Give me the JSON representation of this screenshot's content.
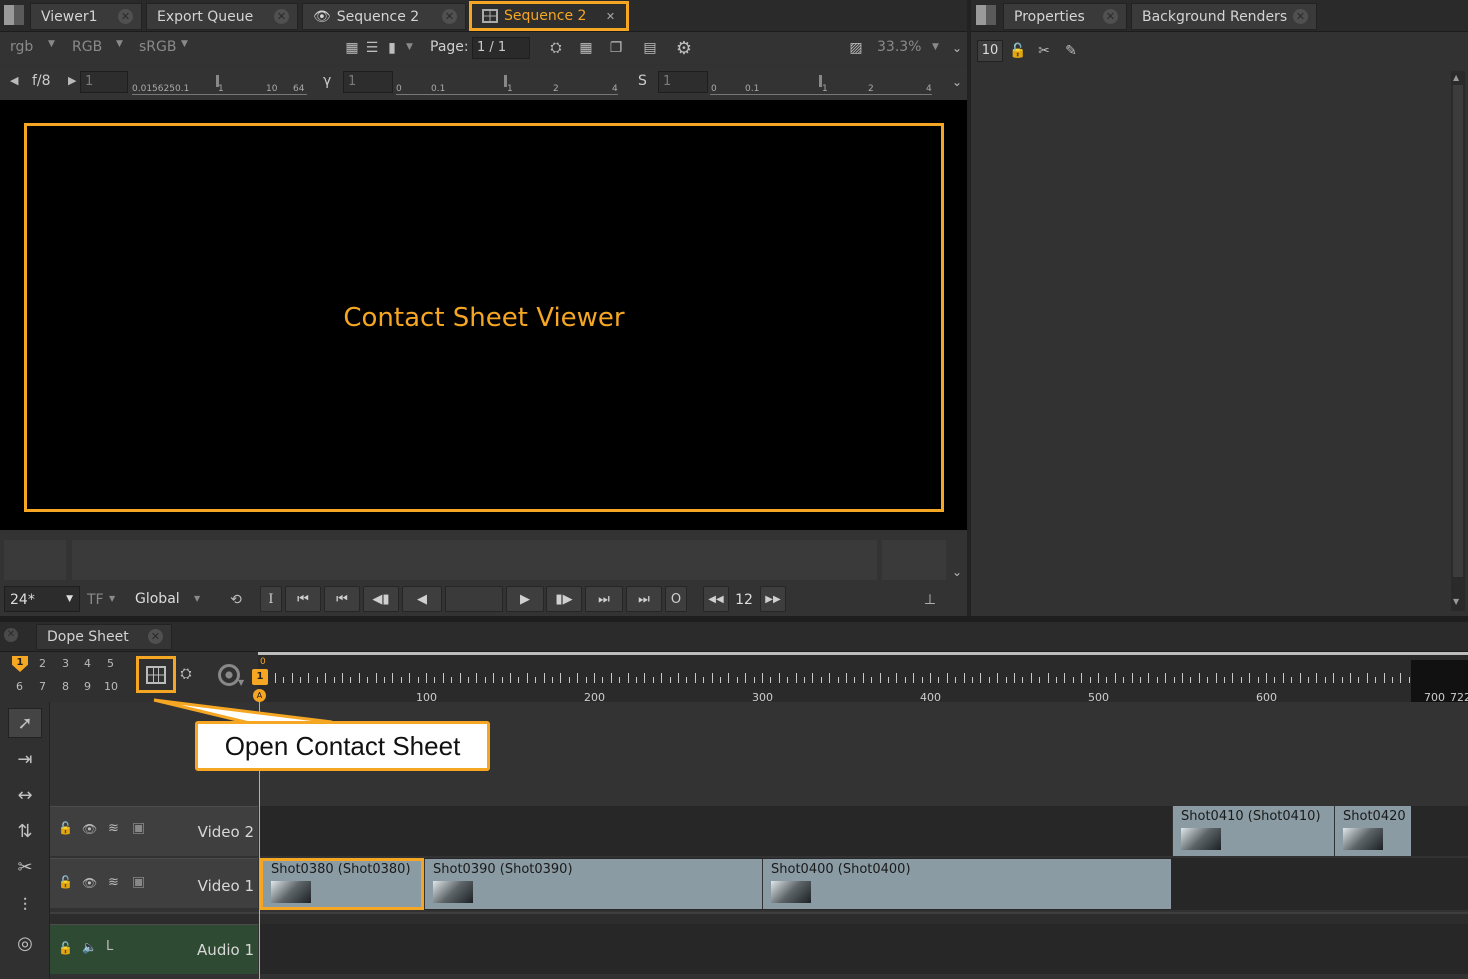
{
  "tabs": {
    "left": [
      {
        "label": "Viewer1"
      },
      {
        "label": "Export Queue"
      },
      {
        "label": "Sequence 2"
      },
      {
        "label": "Sequence 2",
        "active": true
      }
    ],
    "right": [
      {
        "label": "Properties"
      },
      {
        "label": "Background Renders"
      }
    ]
  },
  "viewer_toolbar": {
    "channels": "rgb",
    "color_mode": "RGB",
    "colorspace": "sRGB",
    "page_label": "Page:",
    "page_value": "1 / 1",
    "zoom": "33.3%"
  },
  "sliders": {
    "fstop_label": "f/8",
    "gain_value": "1",
    "gain_ticks": [
      "0.015625",
      "0.1",
      "1",
      "10",
      "64"
    ],
    "gamma_label": "γ",
    "gamma_value": "1",
    "gamma_ticks": [
      "0",
      "0.1",
      "1",
      "2",
      "4"
    ],
    "sat_label": "S",
    "sat_value": "1",
    "sat_ticks": [
      "0",
      "0.1",
      "1",
      "2",
      "4"
    ]
  },
  "viewer": {
    "label": "Contact Sheet Viewer",
    "accent": "#f5a623"
  },
  "playback": {
    "fps": "24*",
    "tf": "TF",
    "scope": "Global",
    "in_label": "I",
    "out_label": "O",
    "step": "12"
  },
  "properties": {
    "max_panels": "10"
  },
  "dope_sheet": {
    "tab_label": "Dope Sheet",
    "presets_top": [
      "1",
      "2",
      "3",
      "4",
      "5"
    ],
    "presets_bottom": [
      "6",
      "7",
      "8",
      "9",
      "10"
    ],
    "playhead_frame": "1",
    "playhead_top": "0",
    "playhead_marker": "A",
    "ruler_labels": [
      "100",
      "200",
      "300",
      "400",
      "500",
      "600",
      "700",
      "722"
    ],
    "callout": "Open Contact Sheet",
    "tracks": [
      {
        "name": "Video 2"
      },
      {
        "name": "Video 1"
      },
      {
        "name": "Audio 1",
        "channel": "L"
      }
    ],
    "video2_clips": [
      {
        "label": "Shot0410 (Shot0410)"
      },
      {
        "label": "Shot0420"
      }
    ],
    "video1_clips": [
      {
        "label": "Shot0380 (Shot0380)"
      },
      {
        "label": "Shot0390 (Shot0390)"
      },
      {
        "label": "Shot0400 (Shot0400)"
      }
    ]
  }
}
